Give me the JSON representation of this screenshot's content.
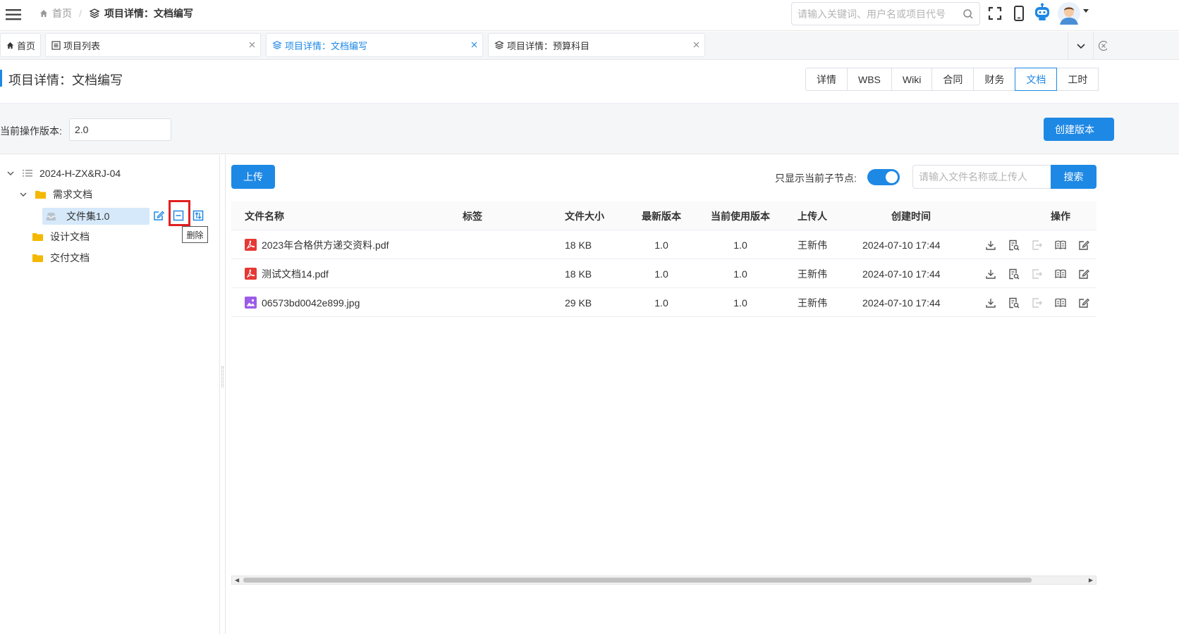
{
  "header": {
    "breadcrumbs": [
      "首页",
      "项目详情：文档编写"
    ],
    "search_placeholder": "请输入关键词、用户名或项目代号",
    "icons": [
      "menu-icon",
      "home-icon",
      "layers-icon",
      "search-icon",
      "fullscreen-icon",
      "mobile-icon",
      "robot-icon",
      "avatar",
      "caret-down-icon"
    ]
  },
  "tabs": [
    {
      "label": "首页"
    },
    {
      "label": "项目列表"
    },
    {
      "label": "项目详情：文档编写",
      "active": true
    },
    {
      "label": "项目详情：预算科目"
    }
  ],
  "page": {
    "title": "项目详情：文档编写",
    "views": [
      "详情",
      "WBS",
      "Wiki",
      "合同",
      "财务",
      "文档",
      "工时"
    ],
    "active_view": "文档"
  },
  "version": {
    "label": "当前操作版本:",
    "value": "2.0",
    "create_label": "创建版本"
  },
  "tree": {
    "root": "2024-H-ZX&RJ-04",
    "nodes": {
      "req": "需求文档",
      "fileset": "文件集1.0",
      "design": "设计文档",
      "delivery": "交付文档"
    },
    "tooltip": "删除"
  },
  "toolbar": {
    "upload_label": "上传",
    "only_children_label": "只显示当前子节点:",
    "only_children_on": true,
    "search_placeholder": "请输入文件名称或上传人",
    "search_label": "搜索"
  },
  "table": {
    "headers": {
      "name": "文件名称",
      "tag": "标签",
      "size": "文件大小",
      "latest": "最新版本",
      "current": "当前使用版本",
      "uploader": "上传人",
      "time": "创建时间",
      "ops": "操作"
    },
    "rows": [
      {
        "type": "pdf",
        "name": "2023年合格供方递交资料.pdf",
        "tag": "",
        "size": "18 KB",
        "latest": "1.0",
        "current": "1.0",
        "uploader": "王新伟",
        "time": "2024-07-10 17:44"
      },
      {
        "type": "pdf",
        "name": "测试文档14.pdf",
        "tag": "",
        "size": "18 KB",
        "latest": "1.0",
        "current": "1.0",
        "uploader": "王新伟",
        "time": "2024-07-10 17:44"
      },
      {
        "type": "image",
        "name": "06573bd0042e899.jpg",
        "tag": "",
        "size": "29 KB",
        "latest": "1.0",
        "current": "1.0",
        "uploader": "王新伟",
        "time": "2024-07-10 17:44"
      }
    ]
  },
  "colors": {
    "primary": "#1e88e5",
    "selected_bg": "#d6e9fb",
    "highlight": "#e02020",
    "folder": "#f5b800",
    "pdf": "#e53935",
    "image": "#9c5be8"
  }
}
